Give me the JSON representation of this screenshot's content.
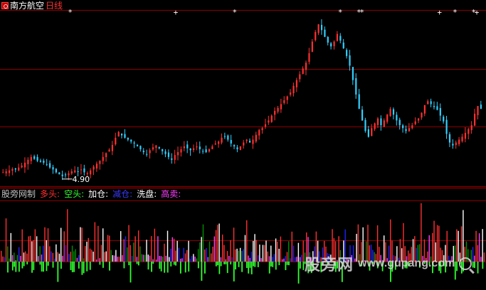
{
  "header": {
    "stock_name": "南方航空",
    "period": "日线",
    "colors": {
      "stock_name": "#ffffff",
      "period": "#ff3030"
    }
  },
  "indicator": {
    "name": "股旁网制",
    "labels": [
      {
        "text": "多头:",
        "color": "#ff3030"
      },
      {
        "text": "空头:",
        "color": "#30ff30"
      },
      {
        "text": "加仓:",
        "color": "#ffffff"
      },
      {
        "text": "减仓:",
        "color": "#3a3aff"
      },
      {
        "text": "洗盘:",
        "color": "#ffffff"
      },
      {
        "text": "高卖:",
        "color": "#ff40ff"
      }
    ]
  },
  "low_marker": "4.90",
  "watermark": {
    "cn": "股旁网",
    "en": "www.gupang.com"
  },
  "chart_data": {
    "type": "candlestick",
    "count": 150,
    "closes": [
      4.98,
      5.0,
      5.02,
      5.05,
      5.04,
      5.08,
      5.12,
      5.18,
      5.24,
      5.3,
      5.26,
      5.22,
      5.2,
      5.18,
      5.14,
      5.08,
      5.04,
      4.98,
      4.94,
      4.9,
      4.92,
      4.96,
      5.0,
      5.02,
      5.0,
      5.04,
      4.98,
      4.96,
      5.02,
      5.1,
      5.16,
      5.22,
      5.3,
      5.38,
      5.45,
      5.55,
      5.7,
      5.82,
      5.75,
      5.7,
      5.66,
      5.62,
      5.58,
      5.52,
      5.46,
      5.4,
      5.36,
      5.44,
      5.5,
      5.54,
      5.48,
      5.42,
      5.36,
      5.3,
      5.24,
      5.34,
      5.4,
      5.46,
      5.52,
      5.48,
      5.44,
      5.48,
      5.52,
      5.46,
      5.42,
      5.4,
      5.46,
      5.52,
      5.58,
      5.62,
      5.7,
      5.72,
      5.66,
      5.58,
      5.52,
      5.46,
      5.52,
      5.6,
      5.66,
      5.6,
      5.66,
      5.76,
      5.86,
      5.9,
      5.98,
      6.06,
      6.16,
      6.26,
      6.32,
      6.4,
      6.48,
      6.56,
      6.64,
      6.78,
      6.9,
      7.02,
      7.14,
      7.26,
      7.46,
      7.7,
      7.9,
      8.06,
      7.94,
      7.8,
      7.68,
      7.6,
      7.7,
      7.86,
      7.72,
      7.56,
      7.4,
      7.2,
      6.9,
      6.6,
      6.3,
      6.06,
      5.84,
      5.72,
      5.9,
      6.0,
      6.1,
      5.96,
      6.06,
      6.18,
      6.3,
      6.18,
      6.06,
      5.96,
      5.9,
      5.84,
      5.9,
      5.96,
      6.04,
      6.1,
      6.22,
      6.38,
      6.46,
      6.4,
      6.34,
      6.28,
      6.16,
      6.04,
      5.78,
      5.6,
      5.54,
      5.6,
      5.66,
      5.72,
      5.8,
      5.88,
      5.96,
      6.2,
      6.36,
      6.3
    ],
    "ylim": [
      4.75,
      8.3
    ],
    "low_value": 4.9,
    "signal_stars": [
      "*",
      "+",
      "*",
      "*",
      "*",
      "*",
      "+",
      "*",
      "*",
      "+",
      "*",
      "*",
      "*"
    ]
  },
  "colors": {
    "up": "#ff3030",
    "down": "#30d0ff",
    "grid": "#8b0000",
    "vol_red": "#ff3030",
    "vol_white": "#ffffff",
    "vol_blue": "#2020ff",
    "vol_green": "#30ff30",
    "vol_dkgreen": "#009000",
    "vol_magenta": "#ff40ff"
  }
}
